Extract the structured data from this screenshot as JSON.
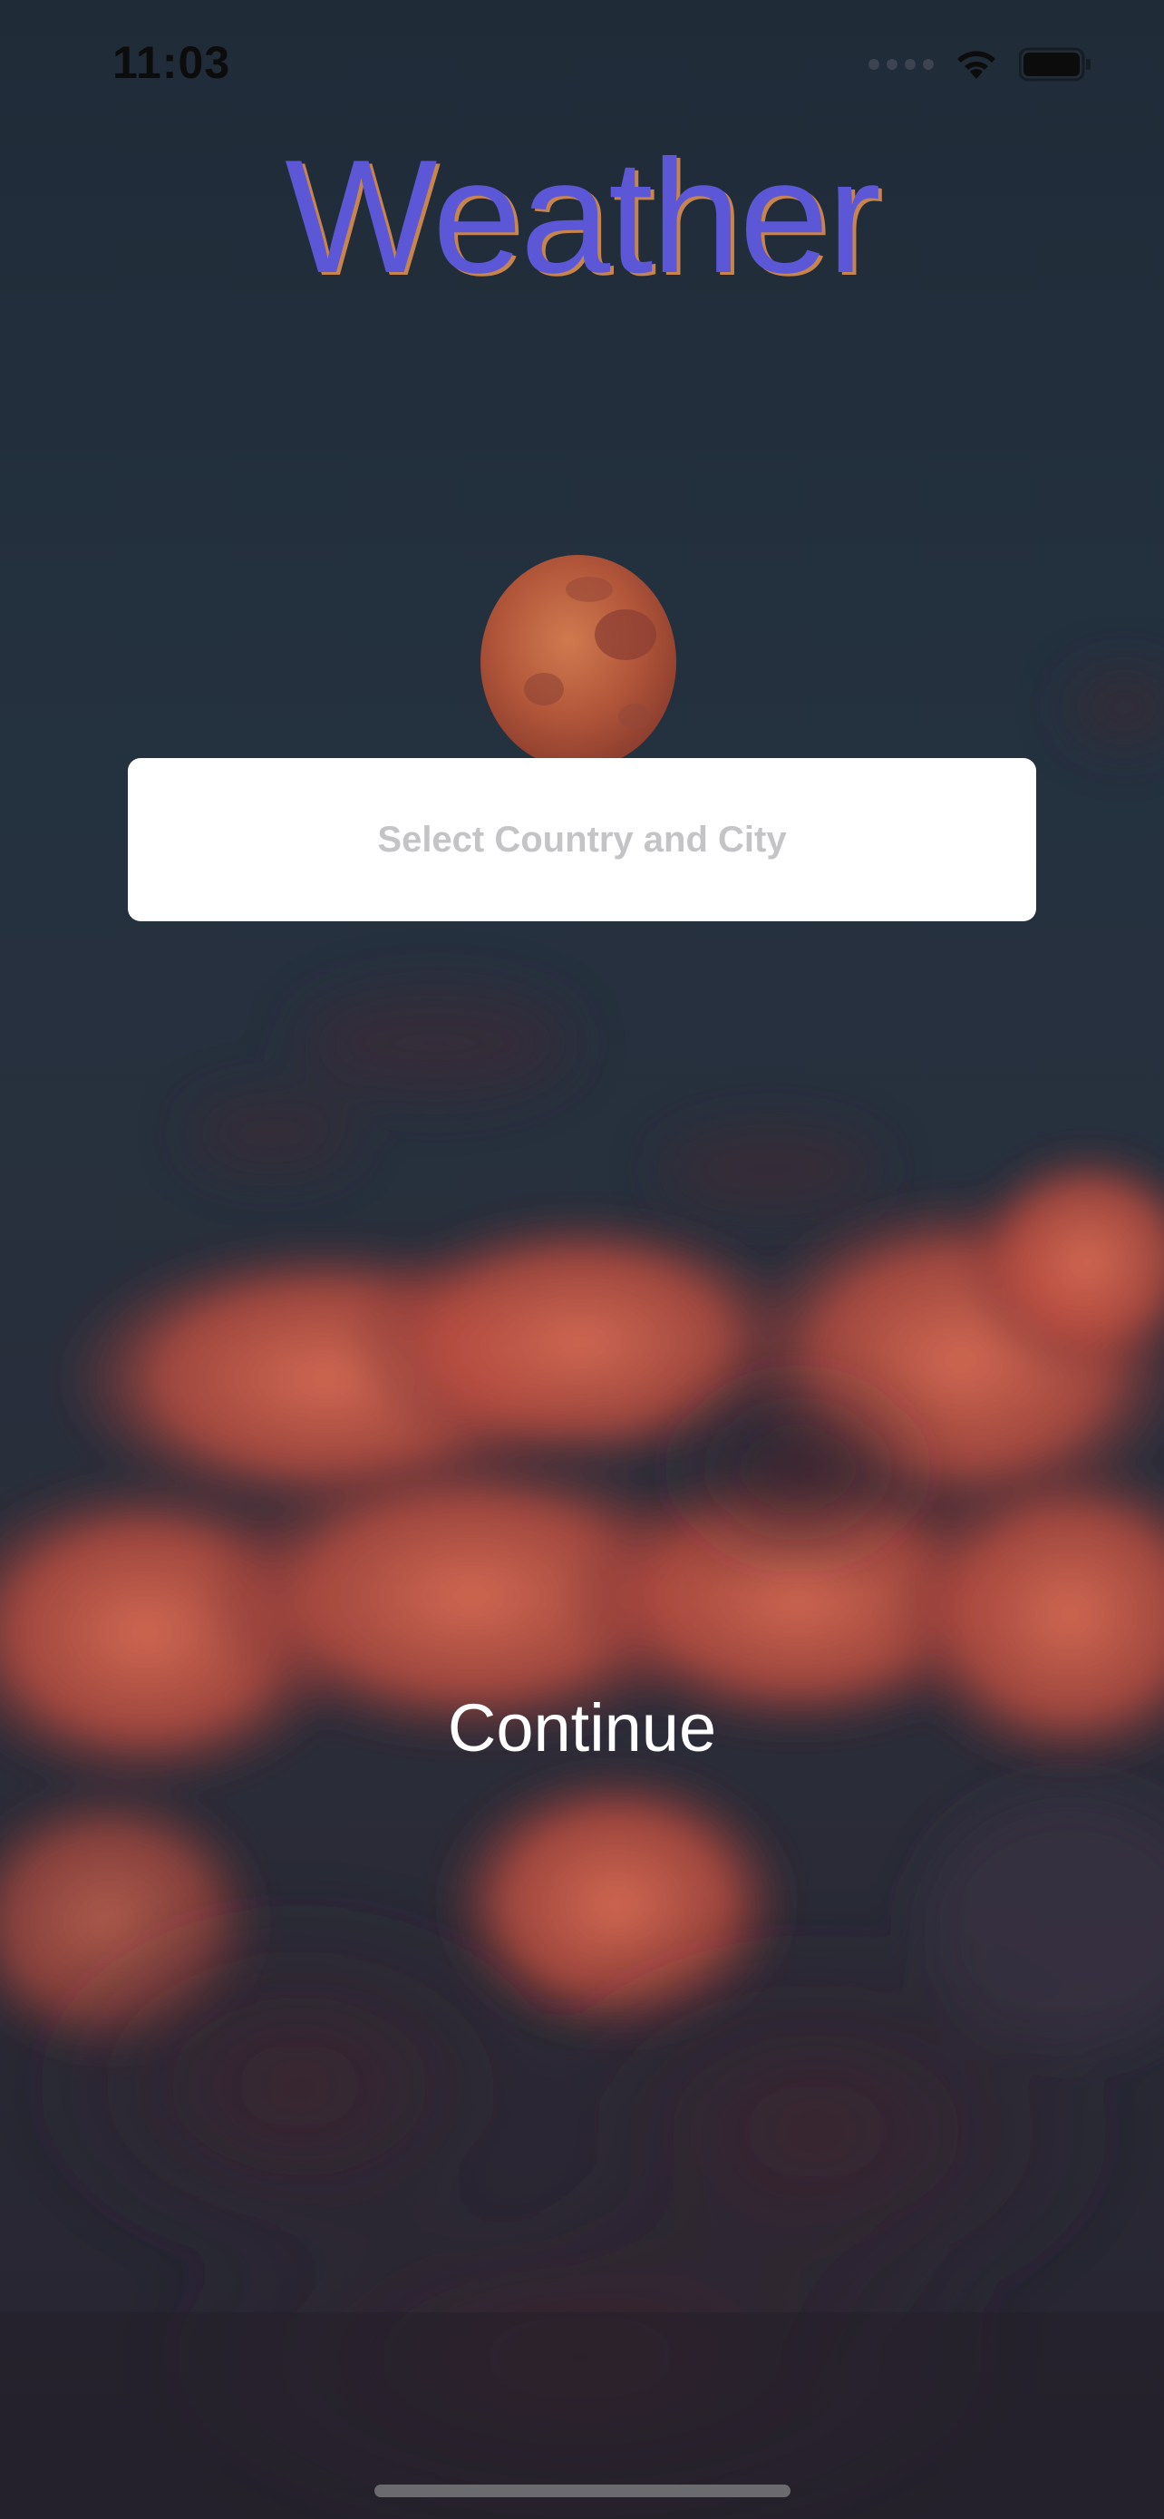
{
  "status_bar": {
    "time": "11:03",
    "icons": [
      "cellular-signal-icon",
      "wifi-icon",
      "battery-icon"
    ]
  },
  "app": {
    "title": "Weather"
  },
  "location_picker": {
    "placeholder": "Select Country and City"
  },
  "actions": {
    "continue_label": "Continue"
  },
  "colors": {
    "title": "#5b57d6",
    "title_shadow": "#c7844c",
    "field_background": "#ffffff",
    "placeholder": "#c4c4c7",
    "button_text": "#ffffff"
  },
  "background": {
    "subject": "night sky with full orange moon and red clouds"
  }
}
